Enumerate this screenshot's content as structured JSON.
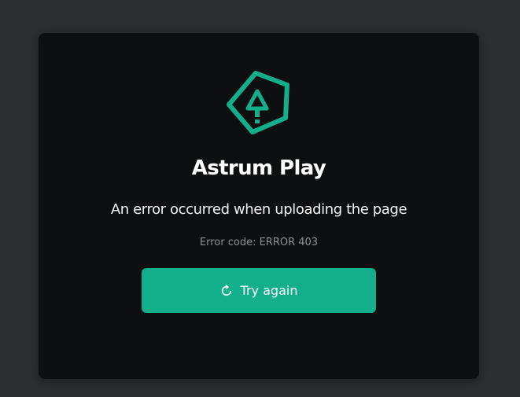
{
  "brand": {
    "name": "Astrum Play",
    "logo_icon": "astrum-pentagon-logo-icon",
    "accent_color": "#13ae8a"
  },
  "error": {
    "message": "An error occurred when uploading the page",
    "code_text": "Error code: ERROR 403"
  },
  "actions": {
    "retry_label": "Try again",
    "retry_icon": "refresh-icon"
  }
}
